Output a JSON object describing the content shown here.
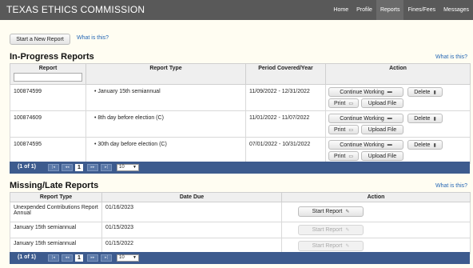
{
  "app": {
    "title": "TEXAS ETHICS COMMISSION"
  },
  "nav": [
    {
      "label": "Home"
    },
    {
      "label": "Profile"
    },
    {
      "label": "Reports"
    },
    {
      "label": "Fines/Fees"
    },
    {
      "label": "Messages"
    }
  ],
  "toolbar": {
    "start_new_report": "Start a New Report",
    "what_is_this": "What is this?"
  },
  "in_progress": {
    "heading": "In-Progress Reports",
    "what_is_this": "What is this?",
    "columns": [
      "Report",
      "Report Type",
      "Period Covered/Year",
      "Action"
    ],
    "rows": [
      {
        "report": "100874599",
        "type": "January 15th semiannual",
        "period": "11/09/2022 - 12/31/2022"
      },
      {
        "report": "100874609",
        "type": "8th day before election (C)",
        "period": "11/01/2022 - 11/07/2022"
      },
      {
        "report": "100874595",
        "type": "30th day before election (C)",
        "period": "07/01/2022 - 10/31/2022"
      }
    ],
    "actions": {
      "continue": "Continue Working",
      "delete": "Delete",
      "print": "Print",
      "upload": "Upload File"
    },
    "pager": {
      "count": "(1 of 1)",
      "current_page": "1",
      "page_size": "10"
    }
  },
  "missing": {
    "heading": "Missing/Late Reports",
    "what_is_this": "What is this?",
    "columns": [
      "Report Type",
      "Date Due",
      "Action"
    ],
    "rows": [
      {
        "type": "Unexpended Contributions Report Annual",
        "due": "01/16/2023",
        "enabled": true
      },
      {
        "type": "January 15th semiannual",
        "due": "01/15/2023",
        "enabled": false
      },
      {
        "type": "January 15th semiannual",
        "due": "01/15/2022",
        "enabled": false
      }
    ],
    "action_label": "Start Report",
    "pager": {
      "count": "(1 of 1)",
      "current_page": "1",
      "page_size": "10"
    }
  },
  "colors": {
    "topbar": "#595959",
    "pager": "#3d5b8e",
    "link": "#2466b4",
    "background": "#fffdf2"
  }
}
